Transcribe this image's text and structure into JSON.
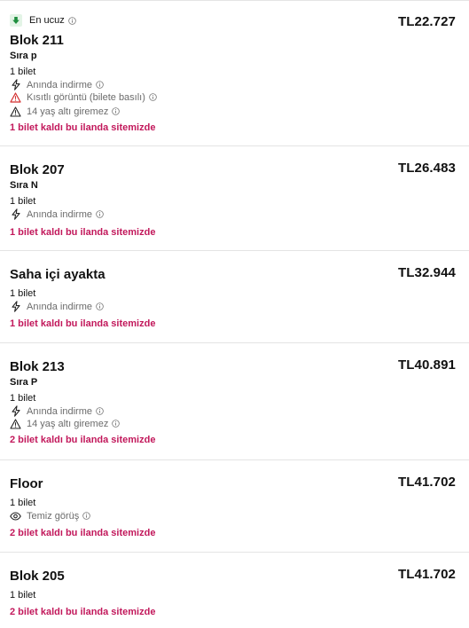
{
  "listings": [
    {
      "badge": "En ucuz",
      "title": "Blok 211",
      "row": "Sıra p",
      "quantity": "1 bilet",
      "price": "TL22.727",
      "features": [
        {
          "icon": "bolt-icon",
          "text": "Anında indirme"
        },
        {
          "icon": "warning-red-icon",
          "text": "Kısıtlı görüntü (bilete basılı)"
        },
        {
          "icon": "warning-icon",
          "text": "14 yaş altı giremez"
        }
      ],
      "availability": "1 bilet kaldı bu ilanda sitemizde"
    },
    {
      "title": "Blok 207",
      "row": "Sıra N",
      "quantity": "1 bilet",
      "price": "TL26.483",
      "features": [
        {
          "icon": "bolt-icon",
          "text": "Anında indirme"
        }
      ],
      "availability": "1 bilet kaldı bu ilanda sitemizde"
    },
    {
      "title": "Saha içi ayakta",
      "quantity": "1 bilet",
      "price": "TL32.944",
      "features": [
        {
          "icon": "bolt-icon",
          "text": "Anında indirme"
        }
      ],
      "availability": "1 bilet kaldı bu ilanda sitemizde"
    },
    {
      "title": "Blok 213",
      "row": "Sıra P",
      "quantity": "1 bilet",
      "price": "TL40.891",
      "features": [
        {
          "icon": "bolt-icon",
          "text": "Anında indirme"
        },
        {
          "icon": "warning-icon",
          "text": "14 yaş altı giremez"
        }
      ],
      "availability": "2 bilet kaldı bu ilanda sitemizde"
    },
    {
      "title": "Floor",
      "quantity": "1 bilet",
      "price": "TL41.702",
      "features": [
        {
          "icon": "eye-icon",
          "text": "Temiz görüş"
        }
      ],
      "availability": "2 bilet kaldı bu ilanda sitemizde"
    },
    {
      "title": "Blok 205",
      "quantity": "1 bilet",
      "price": "TL41.702",
      "features": [],
      "availability": "2 bilet kaldı bu ilanda sitemizde"
    }
  ],
  "colors": {
    "availability": "#c2185b",
    "badge_bg": "#e3f4e6",
    "badge_icon": "#1e8e3e",
    "warning_red": "#d32f2f",
    "divider": "#e4e4e4"
  }
}
